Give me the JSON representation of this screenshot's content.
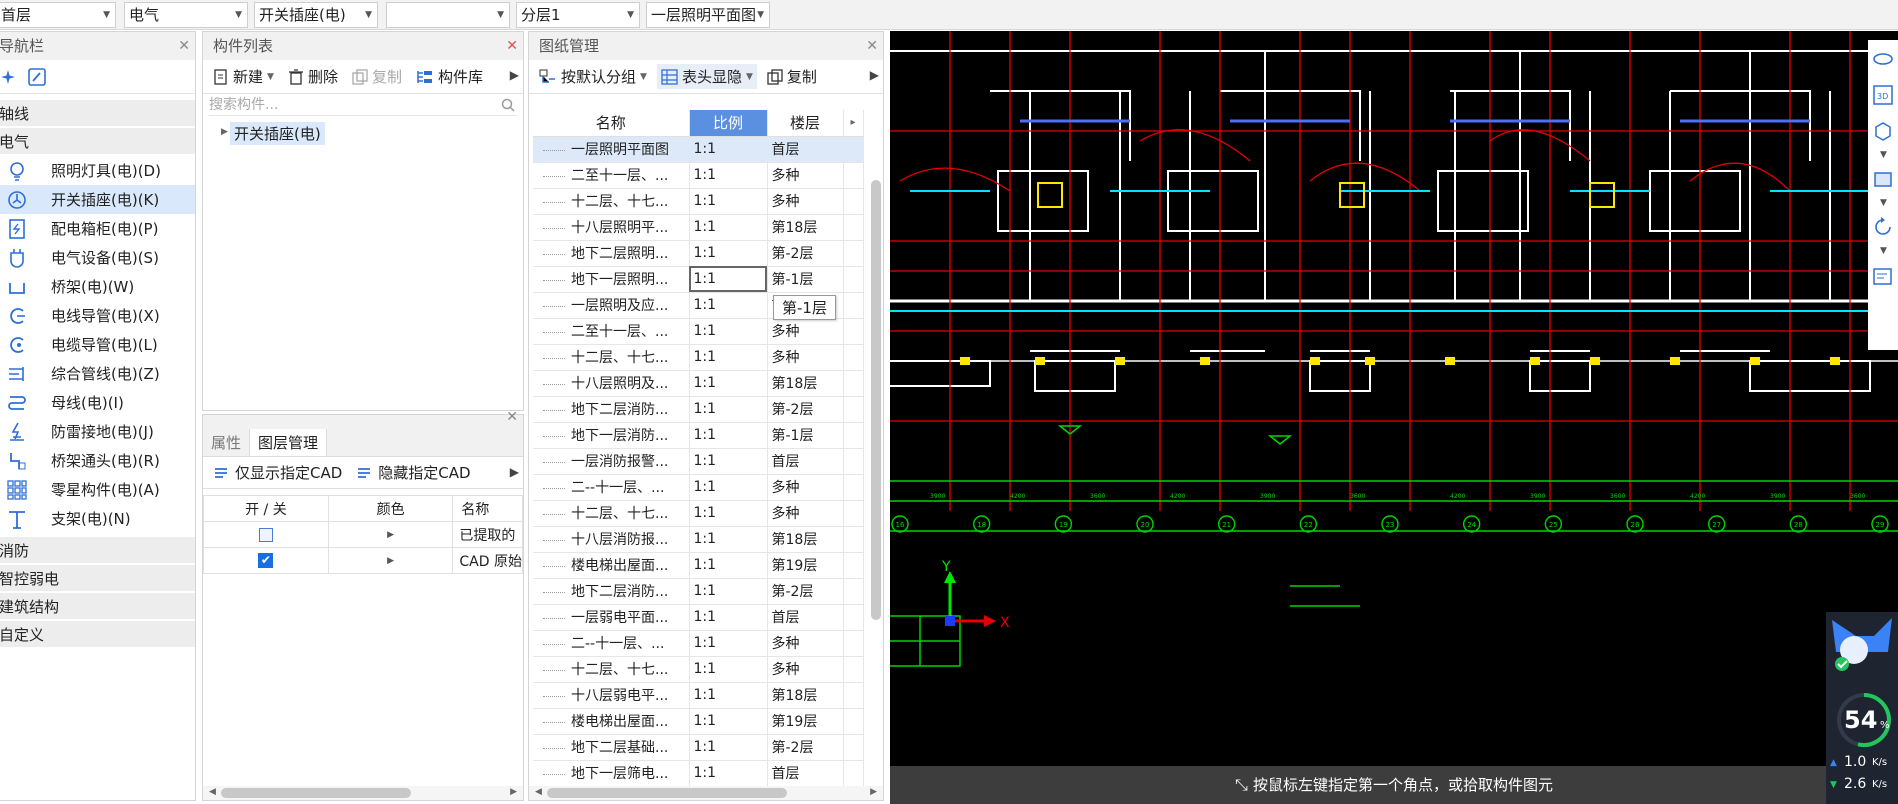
{
  "topbar": {
    "dropdowns": [
      {
        "value": "首层"
      },
      {
        "value": "电气"
      },
      {
        "value": "开关插座(电)"
      },
      {
        "value": ""
      },
      {
        "value": "分层1"
      },
      {
        "value": "一层照明平面图"
      }
    ]
  },
  "nav": {
    "title": "导航栏",
    "categories": [
      {
        "label": "轴线"
      },
      {
        "label": "电气"
      }
    ],
    "items": [
      {
        "label": "照明灯具(电)(D)",
        "icon": "lamp-icon"
      },
      {
        "label": "开关插座(电)(K)",
        "icon": "switch-socket-icon",
        "selected": true
      },
      {
        "label": "配电箱柜(电)(P)",
        "icon": "distribution-box-icon"
      },
      {
        "label": "电气设备(电)(S)",
        "icon": "electrical-device-icon"
      },
      {
        "label": "桥架(电)(W)",
        "icon": "cable-tray-icon"
      },
      {
        "label": "电线导管(电)(X)",
        "icon": "wire-conduit-icon"
      },
      {
        "label": "电缆导管(电)(L)",
        "icon": "cable-conduit-icon"
      },
      {
        "label": "综合管线(电)(Z)",
        "icon": "combined-pipeline-icon"
      },
      {
        "label": "母线(电)(I)",
        "icon": "busbar-icon"
      },
      {
        "label": "防雷接地(电)(J)",
        "icon": "lightning-ground-icon"
      },
      {
        "label": "桥架通头(电)(R)",
        "icon": "tray-fitting-icon"
      },
      {
        "label": "零星构件(电)(A)",
        "icon": "misc-component-icon"
      },
      {
        "label": "支架(电)(N)",
        "icon": "bracket-icon"
      }
    ],
    "bottom_categories": [
      {
        "label": "消防"
      },
      {
        "label": "智控弱电"
      },
      {
        "label": "建筑结构"
      },
      {
        "label": "自定义"
      }
    ]
  },
  "component_list": {
    "title": "构件列表",
    "toolbar": {
      "new": "新建",
      "delete": "删除",
      "copy": "复制",
      "library": "构件库"
    },
    "search_placeholder": "搜索构件...",
    "tree_item": "开关插座(电)"
  },
  "layer_panel": {
    "tabs": [
      "属性",
      "图层管理"
    ],
    "toolbar": {
      "show_only": "仅显示指定CAD",
      "hide": "隐藏指定CAD"
    },
    "columns": [
      "开 / 关",
      "颜色",
      "名称"
    ],
    "rows": [
      {
        "checked": false,
        "name": "已提取的"
      },
      {
        "checked": true,
        "name": "CAD 原始"
      }
    ]
  },
  "drawing_mgmt": {
    "title": "图纸管理",
    "toolbar": {
      "group": "按默认分组",
      "header_toggle": "表头显隐",
      "copy": "复制"
    },
    "columns": {
      "name": "名称",
      "scale": "比例",
      "floor": "楼层"
    },
    "tooltip": "第-1层",
    "rows": [
      {
        "name": "一层照明平面图",
        "scale": "1:1",
        "floor": "首层"
      },
      {
        "name": "二至十一层、...",
        "scale": "1:1",
        "floor": "多种"
      },
      {
        "name": "十二层、十七...",
        "scale": "1:1",
        "floor": "多种"
      },
      {
        "name": "十八层照明平...",
        "scale": "1:1",
        "floor": "第18层"
      },
      {
        "name": "地下二层照明...",
        "scale": "1:1",
        "floor": "第-2层"
      },
      {
        "name": "地下一层照明...",
        "scale": "1:1",
        "floor": "第-1层"
      },
      {
        "name": "一层照明及应...",
        "scale": "1:1",
        "floor": "首"
      },
      {
        "name": "二至十一层、...",
        "scale": "1:1",
        "floor": "多种"
      },
      {
        "name": "十二层、十七...",
        "scale": "1:1",
        "floor": "多种"
      },
      {
        "name": "十八层照明及...",
        "scale": "1:1",
        "floor": "第18层"
      },
      {
        "name": "地下二层消防...",
        "scale": "1:1",
        "floor": "第-2层"
      },
      {
        "name": "地下一层消防...",
        "scale": "1:1",
        "floor": "第-1层"
      },
      {
        "name": "一层消防报警...",
        "scale": "1:1",
        "floor": "首层"
      },
      {
        "name": "二--十一层、...",
        "scale": "1:1",
        "floor": "多种"
      },
      {
        "name": "十二层、十七...",
        "scale": "1:1",
        "floor": "多种"
      },
      {
        "name": "十八层消防报...",
        "scale": "1:1",
        "floor": "第18层"
      },
      {
        "name": "楼电梯出屋面...",
        "scale": "1:1",
        "floor": "第19层"
      },
      {
        "name": "地下二层消防...",
        "scale": "1:1",
        "floor": "第-2层"
      },
      {
        "name": "一层弱电平面...",
        "scale": "1:1",
        "floor": "首层"
      },
      {
        "name": "二--十一层、...",
        "scale": "1:1",
        "floor": "多种"
      },
      {
        "name": "十二层、十七...",
        "scale": "1:1",
        "floor": "多种"
      },
      {
        "name": "十八层弱电平...",
        "scale": "1:1",
        "floor": "第18层"
      },
      {
        "name": "楼电梯出屋面...",
        "scale": "1:1",
        "floor": "第19层"
      },
      {
        "name": "地下二层基础...",
        "scale": "1:1",
        "floor": "第-2层"
      },
      {
        "name": "地下一层筛电...",
        "scale": "1:1",
        "floor": "首层"
      }
    ]
  },
  "cad": {
    "status_text": "按鼠标左键指定第一个角点，或拾取构件图元",
    "axis_y": "Y",
    "axis_x": "X",
    "grid_labels": [
      "16",
      "18",
      "19",
      "20",
      "21",
      "22",
      "23",
      "24",
      "25",
      "26",
      "27",
      "28",
      "29"
    ],
    "colors": {
      "red": "#e60000",
      "green": "#00d400",
      "white": "#ffffff",
      "yellow": "#ffe600",
      "cyan": "#00e5ff"
    }
  },
  "widget": {
    "percent": "54",
    "percent_unit": "%",
    "up": "1.0",
    "down": "2.6",
    "unit": "K/s"
  }
}
